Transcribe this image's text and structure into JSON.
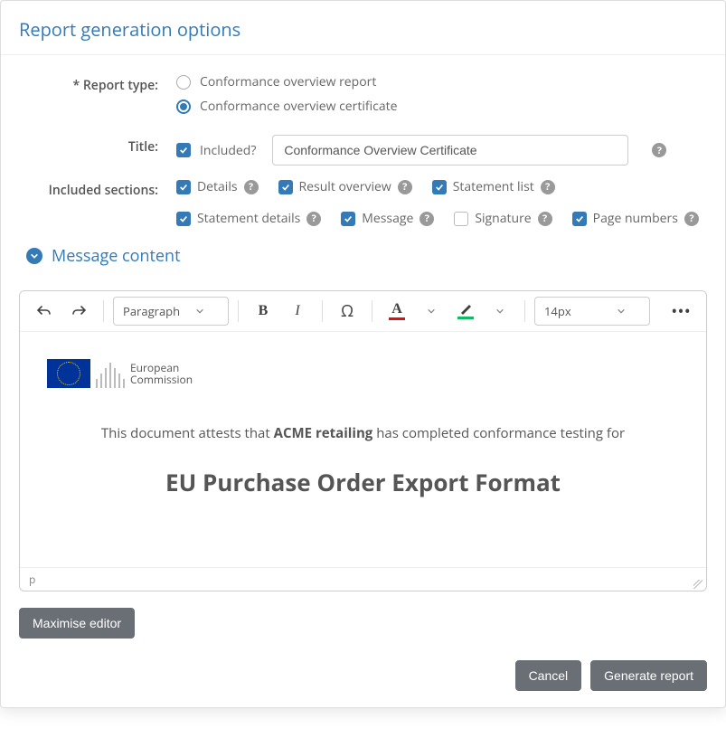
{
  "modal": {
    "title": "Report generation options"
  },
  "form": {
    "report_type_label": "* Report type:",
    "report_type_options": [
      "Conformance overview report",
      "Conformance overview certificate"
    ],
    "title_label": "Title:",
    "included_label": "Included?",
    "title_value": "Conformance Overview Certificate",
    "sections_label": "Included sections:",
    "sections": [
      {
        "label": "Details",
        "checked": true
      },
      {
        "label": "Result overview",
        "checked": true
      },
      {
        "label": "Statement list",
        "checked": true
      },
      {
        "label": "Statement details",
        "checked": true
      },
      {
        "label": "Message",
        "checked": true
      },
      {
        "label": "Signature",
        "checked": false
      },
      {
        "label": "Page numbers",
        "checked": true
      }
    ]
  },
  "collapsible": {
    "title": "Message content"
  },
  "editor": {
    "paragraph_style": "Paragraph",
    "font_size": "14px",
    "status_path": "p",
    "logo_text_1": "European",
    "logo_text_2": "Commission",
    "attest_prefix": "This document attests that ",
    "attest_org": "ACME retailing",
    "attest_suffix": " has completed conformance testing for",
    "big_title": "EU Purchase Order Export Format"
  },
  "buttons": {
    "maximise": "Maximise editor",
    "cancel": "Cancel",
    "generate": "Generate report"
  }
}
